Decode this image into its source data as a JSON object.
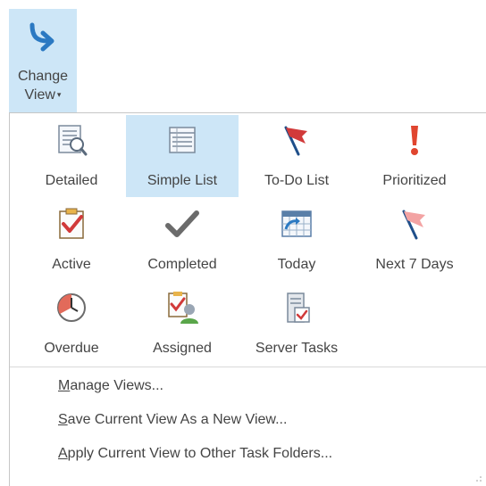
{
  "ribbon": {
    "change_view_line1": "Change",
    "change_view_line2": "View",
    "caret": "▾",
    "icon": "change-view-arrow-icon"
  },
  "gallery": {
    "items": [
      {
        "label": "Detailed",
        "icon": "detailed-view-icon",
        "selected": false
      },
      {
        "label": "Simple List",
        "icon": "simple-list-icon",
        "selected": true
      },
      {
        "label": "To-Do List",
        "icon": "todo-flag-icon",
        "selected": false
      },
      {
        "label": "Prioritized",
        "icon": "exclamation-icon",
        "selected": false
      },
      {
        "label": "Active",
        "icon": "clipboard-check-icon",
        "selected": false
      },
      {
        "label": "Completed",
        "icon": "checkmark-icon",
        "selected": false
      },
      {
        "label": "Today",
        "icon": "calendar-arrow-icon",
        "selected": false
      },
      {
        "label": "Next 7 Days",
        "icon": "pink-flag-icon",
        "selected": false
      },
      {
        "label": "Overdue",
        "icon": "clock-icon",
        "selected": false
      },
      {
        "label": "Assigned",
        "icon": "assigned-person-icon",
        "selected": false
      },
      {
        "label": "Server Tasks",
        "icon": "server-tasks-icon",
        "selected": false
      }
    ]
  },
  "menu": {
    "manage_views": {
      "accel": "M",
      "rest": "anage Views..."
    },
    "save_view": {
      "accel": "S",
      "rest": "ave Current View As a New View..."
    },
    "apply_view": {
      "accel": "A",
      "rest": "pply Current View to Other Task Folders..."
    }
  },
  "colors": {
    "selection": "#cde6f7",
    "accent_blue": "#2b79c2",
    "flag_red": "#d13a3a"
  }
}
